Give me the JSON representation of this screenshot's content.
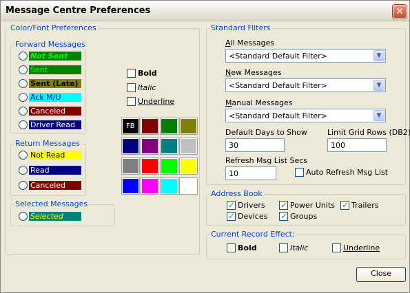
{
  "window": {
    "title": "Message Centre Preferences",
    "close_glyph": "✕"
  },
  "color_font": {
    "legend": "Color/Font Preferences",
    "forward": {
      "legend": "Forward Messages",
      "items": [
        {
          "label": "Not Sent",
          "bg": "#008000",
          "fg": "#00ff00"
        },
        {
          "label": "Sent",
          "bg": "#008000",
          "fg": "#00ff00"
        },
        {
          "label": "Sent (Late)",
          "bg": "#808000",
          "fg": "#000000"
        },
        {
          "label": "Ack M/U",
          "bg": "#00ffff",
          "fg": "#0000aa"
        },
        {
          "label": "Canceled",
          "bg": "#800000",
          "fg": "#ffffff"
        },
        {
          "label": "Driver Read",
          "bg": "#000080",
          "fg": "#ffffff"
        }
      ]
    },
    "return": {
      "legend": "Return Messages",
      "items": [
        {
          "label": "Not Read",
          "bg": "#ffff00",
          "fg": "#000080"
        },
        {
          "label": "Read",
          "bg": "#000080",
          "fg": "#ffffff"
        },
        {
          "label": "Canceled",
          "bg": "#800000",
          "fg": "#ffffff"
        }
      ]
    },
    "selected": {
      "legend": "Selected Messages",
      "items": [
        {
          "label": "Selected",
          "bg": "#008080",
          "fg": "#ffff00"
        }
      ]
    },
    "style": {
      "bold": "Bold",
      "italic": "Italic",
      "underline": "Underline"
    },
    "palette": {
      "sample_text": "FB",
      "colors": [
        "#000000",
        "#800000",
        "#008000",
        "#808000",
        "#000080",
        "#800080",
        "#008080",
        "#c0c0c0",
        "#808080",
        "#ff0000",
        "#00ff00",
        "#ffff00",
        "#0000ff",
        "#ff00ff",
        "#00ffff",
        "#ffffff"
      ]
    }
  },
  "filters": {
    "legend": "Standard Filters",
    "all_label_acc": "A",
    "all_label_rest": "ll Messages",
    "all_value": "<Standard Default Filter>",
    "new_label_acc": "N",
    "new_label_rest": "ew Messages",
    "new_value": "<Standard Default Filter>",
    "manual_label_acc": "M",
    "manual_label_rest": "anual Messages",
    "manual_value": "<Standard Default Filter>",
    "days_label": "Default Days to Show",
    "days_value": "30",
    "limit_label": "Limit Grid Rows (DB2)",
    "limit_value": "100",
    "refresh_label": "Refresh Msg List Secs",
    "refresh_value": "10",
    "auto_refresh_label": "Auto Refresh Msg List",
    "dropdown_glyph": "▼"
  },
  "address_book": {
    "legend": "Address Book",
    "drivers": "Drivers",
    "power_units": "Power Units",
    "trailers": "Trailers",
    "devices": "Devices",
    "groups": "Groups"
  },
  "current_record": {
    "legend": "Current Record Effect:",
    "bold": "Bold",
    "italic": "Italic",
    "underline": "Underline"
  },
  "close_button": "Close"
}
